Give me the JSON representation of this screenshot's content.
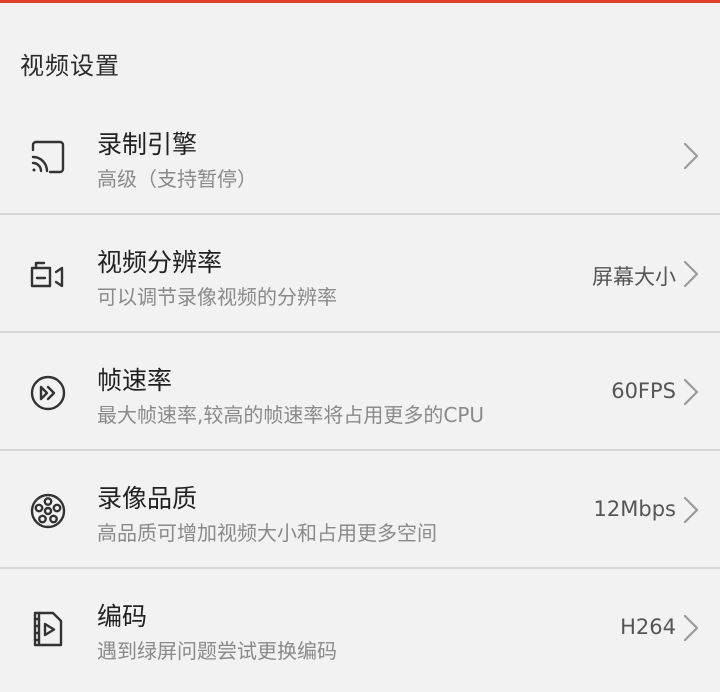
{
  "header": {
    "section_title": "视频设置"
  },
  "settings": [
    {
      "title": "录制引擎",
      "subtitle": "高级（支持暂停）",
      "value": "",
      "icon": "cast-icon"
    },
    {
      "title": "视频分辨率",
      "subtitle": "可以调节录像视频的分辨率",
      "value": "屏幕大小",
      "icon": "resolution-icon"
    },
    {
      "title": "帧速率",
      "subtitle": "最大帧速率,较高的帧速率将占用更多的CPU",
      "value": "60FPS",
      "icon": "fast-forward-icon"
    },
    {
      "title": "录像品质",
      "subtitle": "高品质可增加视频大小和占用更多空间",
      "value": "12Mbps",
      "icon": "film-reel-icon"
    },
    {
      "title": "编码",
      "subtitle": "遇到绿屏问题尝试更换编码",
      "value": "H264",
      "icon": "video-file-icon"
    }
  ],
  "colors": {
    "accent": "#e0402b",
    "background": "#f2f2f2",
    "divider": "#d7d7d7"
  }
}
